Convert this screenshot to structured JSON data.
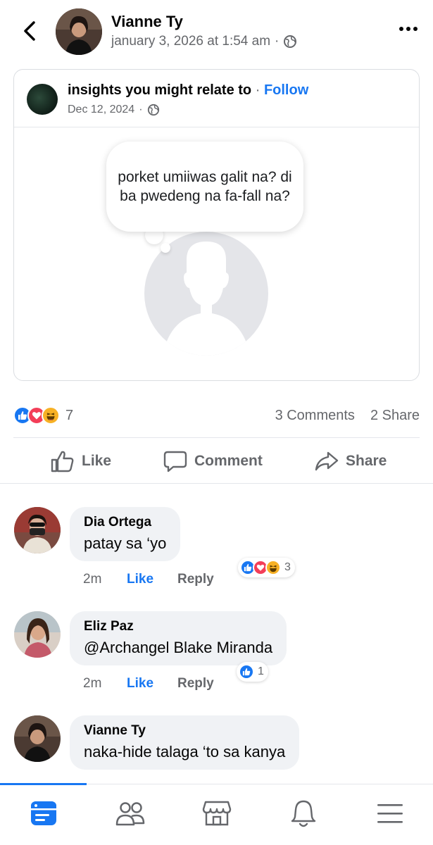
{
  "header": {
    "poster_name": "Vianne Ty",
    "timestamp": "january 3, 2026 at 1:54 am",
    "separator": "·"
  },
  "shared_post": {
    "page_name": "insights you might relate to",
    "separator": "·",
    "follow_label": "Follow",
    "date": "Dec 12, 2024",
    "date_separator": "·",
    "bubble_text": "porket umiiwas galit na? di ba pwedeng na fa-fall na?"
  },
  "stats": {
    "reaction_count": "7",
    "comments": "3 Comments",
    "shares": "2 Share"
  },
  "actions": {
    "like": "Like",
    "comment": "Comment",
    "share": "Share"
  },
  "comments": [
    {
      "name": "Dia Ortega",
      "text": "patay sa ‘yo",
      "time": "2m",
      "like": "Like",
      "reply": "Reply",
      "reaction_count": "3"
    },
    {
      "name": "Eliz Paz",
      "text": "@Archangel Blake Miranda",
      "time": "2m",
      "like": "Like",
      "reply": "Reply",
      "reaction_count": "1"
    },
    {
      "name": "Vianne Ty",
      "text": "naka-hide talaga ‘to sa kanya"
    }
  ],
  "icons": {
    "back": "chevron-left-icon",
    "more": "more-horizontal-icon",
    "globe": "globe-icon",
    "like": "thumbs-up-icon",
    "love": "heart-icon",
    "haha": "laugh-icon",
    "tabs": [
      "feed-icon",
      "friends-icon",
      "marketplace-icon",
      "notifications-icon",
      "menu-icon"
    ]
  },
  "colors": {
    "accent": "#1877f2",
    "love": "#f33e58",
    "haha": "#f7b125",
    "muted_text": "#65676b",
    "bubble_bg": "#f0f2f5"
  }
}
